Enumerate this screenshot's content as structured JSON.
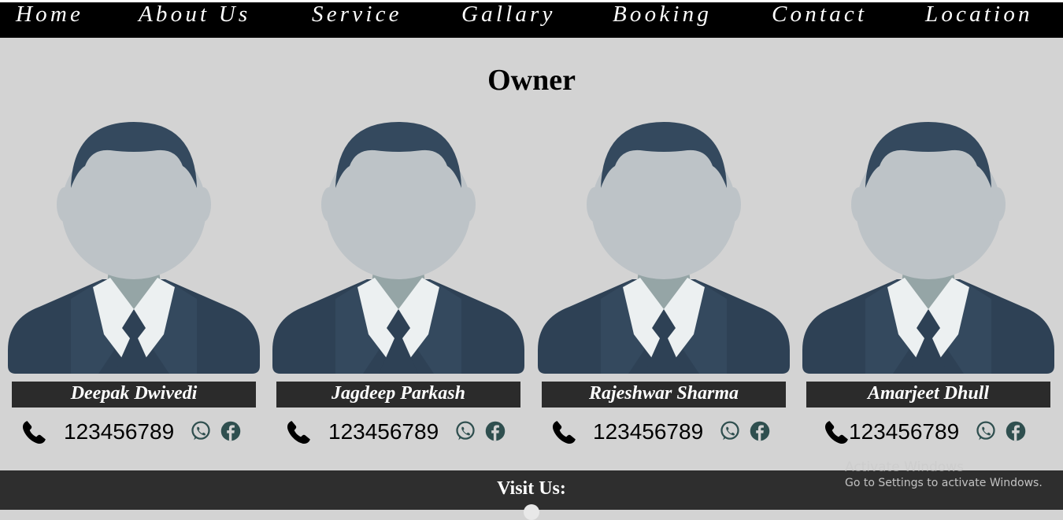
{
  "nav": {
    "items": [
      "Home",
      "About Us",
      "Service",
      "Gallary",
      "Booking",
      "Contact",
      "Location"
    ]
  },
  "section_title": "Owner",
  "owners": [
    {
      "name": "Deepak Dwivedi",
      "phone": "123456789"
    },
    {
      "name": "Jagdeep Parkash",
      "phone": "123456789"
    },
    {
      "name": "Rajeshwar Sharma",
      "phone": "123456789"
    },
    {
      "name": "Amarjeet Dhull",
      "phone": "123456789"
    }
  ],
  "icons": {
    "avatar": "person-avatar-icon",
    "phone": "phone-icon",
    "whatsapp": "whatsapp-icon",
    "facebook": "facebook-icon"
  },
  "colors": {
    "nav_bg": "#000000",
    "page_bg": "#d3d3d3",
    "name_bar": "#2b2b2b",
    "footer_bg": "#2e2e2e",
    "social_icon": "#2f4f4f"
  },
  "footer": {
    "visit_label": "Visit Us:"
  },
  "watermark": {
    "line1": "Activate Windows",
    "line2": "Go to Settings to activate Windows."
  }
}
